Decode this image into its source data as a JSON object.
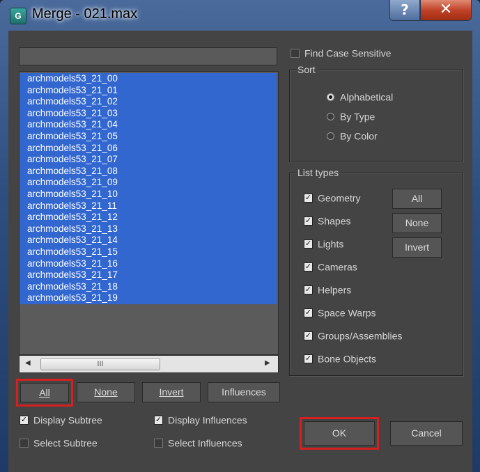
{
  "window": {
    "title": "Merge - 021.max",
    "app_icon_glyph": "G",
    "help_glyph": "?",
    "close_glyph": "✕"
  },
  "objects": {
    "filter_value": "",
    "items": [
      "archmodels53_21_00",
      "archmodels53_21_01",
      "archmodels53_21_02",
      "archmodels53_21_03",
      "archmodels53_21_04",
      "archmodels53_21_05",
      "archmodels53_21_06",
      "archmodels53_21_07",
      "archmodels53_21_08",
      "archmodels53_21_09",
      "archmodels53_21_10",
      "archmodels53_21_11",
      "archmodels53_21_12",
      "archmodels53_21_13",
      "archmodels53_21_14",
      "archmodels53_21_15",
      "archmodels53_21_16",
      "archmodels53_21_17",
      "archmodels53_21_18",
      "archmodels53_21_19"
    ],
    "scroll_thumb_glyph": "III",
    "scroll_left_glyph": "◀",
    "scroll_right_glyph": "▶"
  },
  "selection_buttons": {
    "all": "All",
    "none": "None",
    "invert": "Invert",
    "influences": "Influences"
  },
  "bottom_options": {
    "display_subtree": {
      "label": "Display Subtree",
      "checked": true
    },
    "select_subtree": {
      "label": "Select Subtree",
      "checked": false
    },
    "display_influences": {
      "label": "Display Influences",
      "checked": true
    },
    "select_influences": {
      "label": "Select Influences",
      "checked": false
    }
  },
  "find_case_sensitive": {
    "label": "Find Case Sensitive",
    "checked": false
  },
  "sort": {
    "title": "Sort",
    "options": [
      {
        "label": "Alphabetical",
        "selected": true
      },
      {
        "label": "By Type",
        "selected": false
      },
      {
        "label": "By Color",
        "selected": false
      }
    ]
  },
  "list_types": {
    "title": "List types",
    "items": [
      {
        "label": "Geometry",
        "checked": true
      },
      {
        "label": "Shapes",
        "checked": true
      },
      {
        "label": "Lights",
        "checked": true
      },
      {
        "label": "Cameras",
        "checked": true
      },
      {
        "label": "Helpers",
        "checked": true
      },
      {
        "label": "Space Warps",
        "checked": true
      },
      {
        "label": "Groups/Assemblies",
        "checked": true
      },
      {
        "label": "Bone Objects",
        "checked": true
      }
    ],
    "all_label": "All",
    "none_label": "None",
    "invert_label": "Invert"
  },
  "actions": {
    "ok": "OK",
    "cancel": "Cancel"
  },
  "check_glyph": "✓",
  "highlight_color": "#d42020",
  "selection_color": "#3367d0"
}
